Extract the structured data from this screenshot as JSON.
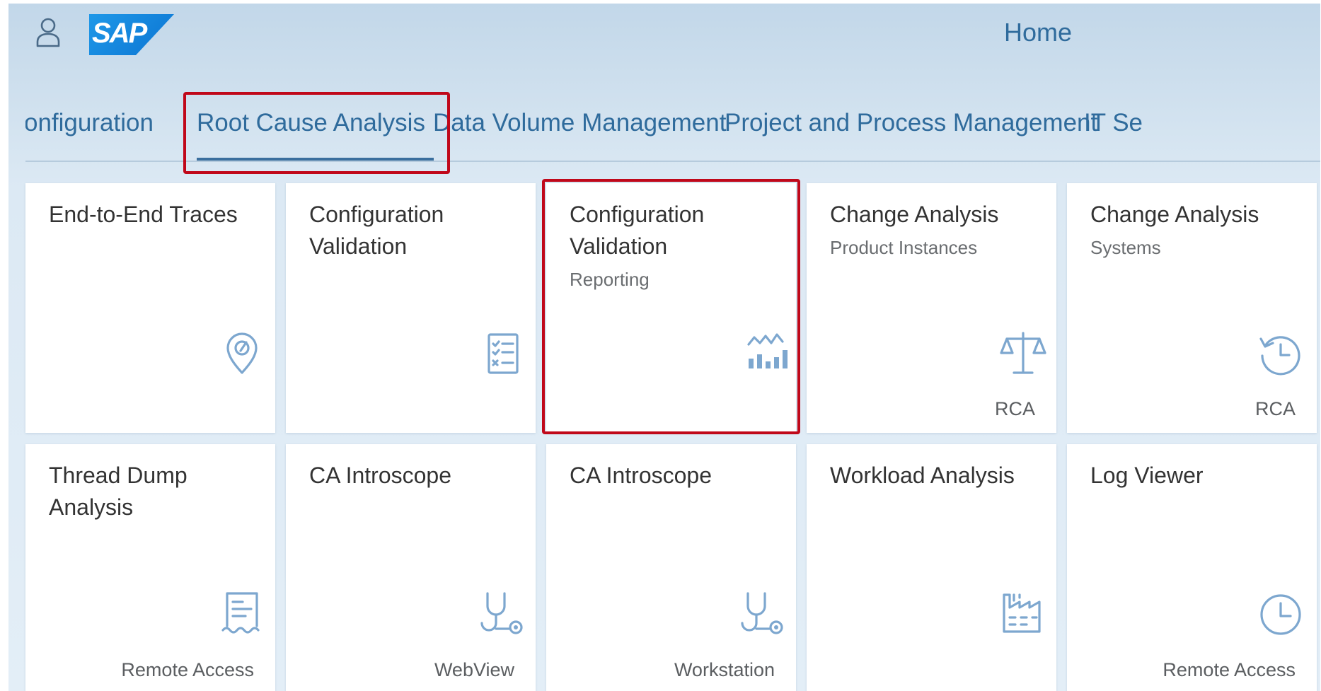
{
  "header": {
    "user_icon": "person-icon",
    "logo_text": "SAP",
    "title": "Home"
  },
  "tabs": [
    {
      "label": "onfiguration",
      "selected": false
    },
    {
      "label": "Root Cause Analysis",
      "selected": true
    },
    {
      "label": "Data Volume Management",
      "selected": false
    },
    {
      "label": "Project and Process Management",
      "selected": false
    },
    {
      "label": "IT Se",
      "selected": false
    }
  ],
  "tiles": [
    {
      "title": "End-to-End Traces",
      "subtitle": "",
      "footer": "",
      "icon": "e2e-trace-icon"
    },
    {
      "title": "Configuration Validation",
      "subtitle": "",
      "footer": "",
      "icon": "checklist-icon"
    },
    {
      "title": "Configuration Validation",
      "subtitle": "Reporting",
      "footer": "",
      "icon": "chart-icon"
    },
    {
      "title": "Change Analysis",
      "subtitle": "Product Instances",
      "footer": "RCA",
      "icon": "balance-scale-icon"
    },
    {
      "title": "Change Analysis",
      "subtitle": "Systems",
      "footer": "RCA",
      "icon": "history-icon"
    },
    {
      "title": "Thread Dump Analysis",
      "subtitle": "",
      "footer": "Remote Access",
      "icon": "receipt-icon"
    },
    {
      "title": "CA Introscope",
      "subtitle": "",
      "footer": "WebView",
      "icon": "stethoscope-icon"
    },
    {
      "title": "CA Introscope",
      "subtitle": "",
      "footer": "Workstation",
      "icon": "stethoscope-icon"
    },
    {
      "title": "Workload Analysis",
      "subtitle": "",
      "footer": "",
      "icon": "factory-icon"
    },
    {
      "title": "Log Viewer",
      "subtitle": "",
      "footer": "Remote Access",
      "icon": "clock-icon"
    }
  ],
  "colors": {
    "accent": "#2f6b9c",
    "icon": "#7da7cf",
    "highlight": "#c0081a"
  }
}
